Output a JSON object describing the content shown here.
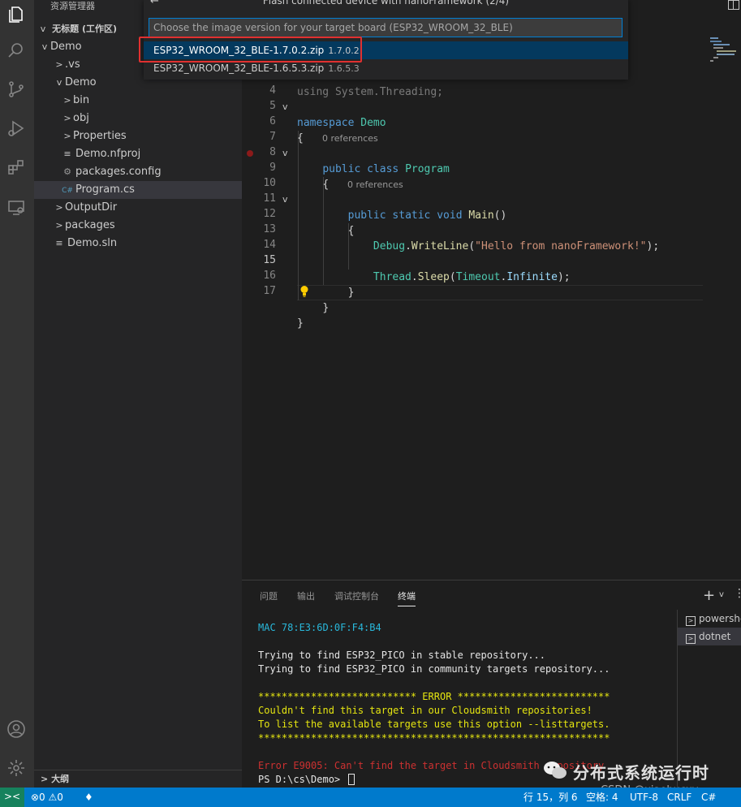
{
  "sidebar": {
    "title": "资源管理器",
    "workspace": "无标题 (工作区)",
    "tree": [
      {
        "label": "Demo",
        "chev": "v",
        "icon": "",
        "indent": 6
      },
      {
        "label": ".vs",
        "chev": ">",
        "icon": "",
        "indent": 24
      },
      {
        "label": "Demo",
        "chev": "v",
        "icon": "",
        "indent": 24
      },
      {
        "label": "bin",
        "chev": ">",
        "icon": "",
        "indent": 34
      },
      {
        "label": "obj",
        "chev": ">",
        "icon": "",
        "indent": 34
      },
      {
        "label": "Properties",
        "chev": ">",
        "icon": "",
        "indent": 34
      },
      {
        "label": "Demo.nfproj",
        "chev": "",
        "icon": "file-icon",
        "indent": 34
      },
      {
        "label": "packages.config",
        "chev": "",
        "icon": "gear-icon",
        "indent": 34
      },
      {
        "label": "Program.cs",
        "chev": "",
        "icon": "csharp-icon",
        "indent": 34
      },
      {
        "label": "OutputDir",
        "chev": ">",
        "icon": "",
        "indent": 24
      },
      {
        "label": "packages",
        "chev": ">",
        "icon": "",
        "indent": 24
      },
      {
        "label": "Demo.sln",
        "chev": "",
        "icon": "file-icon",
        "indent": 24
      }
    ],
    "outline_label": "大纲"
  },
  "quick_pick": {
    "title": "Flash connected device with nanoFramework (2/4)",
    "placeholder": "Choose the image version for your target board (ESP32_WROOM_32_BLE)",
    "items": [
      {
        "label": "ESP32_WROOM_32_BLE-1.7.0.2.zip",
        "desc": "1.7.0.2"
      },
      {
        "label": "ESP32_WROOM_32_BLE-1.6.5.3.zip",
        "desc": "1.6.5.3"
      }
    ]
  },
  "editor": {
    "partial_line_text": "using System.Threading;",
    "lines": [
      {
        "n": "4"
      },
      {
        "n": "5"
      },
      {
        "n": "6"
      },
      {
        "n": "7"
      },
      {
        "n": "8"
      },
      {
        "n": "9"
      },
      {
        "n": "10"
      },
      {
        "n": "11"
      },
      {
        "n": "12"
      },
      {
        "n": "13"
      },
      {
        "n": "14"
      },
      {
        "n": "15"
      },
      {
        "n": "16"
      },
      {
        "n": "17"
      }
    ],
    "codelens": "0 references",
    "code": {
      "namespace_kw": "namespace",
      "namespace_name": "Demo",
      "brace_open": "{",
      "brace_close": "}",
      "public_kw": "public",
      "class_kw": "class",
      "class_name": "Program",
      "static_kw": "static",
      "void_kw": "void",
      "main_name": "Main",
      "parens": "()",
      "debug": "Debug",
      "writeline": "WriteLine",
      "hello": "\"Hello from nanoFramework!\"",
      "thread": "Thread",
      "sleep": "Sleep",
      "timeout": "Timeout",
      "infinite": "Infinite"
    }
  },
  "panel": {
    "tabs": [
      "问题",
      "输出",
      "调试控制台",
      "终端"
    ],
    "active_tab": "终端",
    "terminal_lines": [
      {
        "text": "MAC 78:E3:6D:0F:F4:B4",
        "color": "cyan"
      },
      {
        "text": "",
        "color": "white"
      },
      {
        "text": "Trying to find ESP32_PICO in stable repository...",
        "color": "white"
      },
      {
        "text": "Trying to find ESP32_PICO in community targets repository...",
        "color": "white"
      },
      {
        "text": "",
        "color": "white"
      },
      {
        "text": "*************************** ERROR **************************",
        "color": "yellow"
      },
      {
        "text": "Couldn't find this target in our Cloudsmith repositories!",
        "color": "yellow"
      },
      {
        "text": "To list the available targets use this option --listtargets.",
        "color": "yellow"
      },
      {
        "text": "************************************************************",
        "color": "yellow"
      },
      {
        "text": "",
        "color": "white"
      },
      {
        "text": "Error E9005: Can't find the target in Cloudsmith repository",
        "color": "red"
      },
      {
        "text": "PS D:\\cs\\Demo> ",
        "color": "white",
        "cursor": true
      }
    ],
    "terminals": [
      "powershell",
      "dotnet"
    ]
  },
  "watermark": {
    "text": "分布式系统运行时",
    "sub": "CSDN @xiaohucxy"
  },
  "status_bar": {
    "remote": "><",
    "problems": "⊗0 ⚠0",
    "position": "行 15，列 6",
    "spaces": "空格: 4",
    "encoding": "UTF-8",
    "eol": "CRLF",
    "language": "C#",
    "colors": {
      "bar": "#007acc",
      "remote": "#16825d"
    }
  }
}
